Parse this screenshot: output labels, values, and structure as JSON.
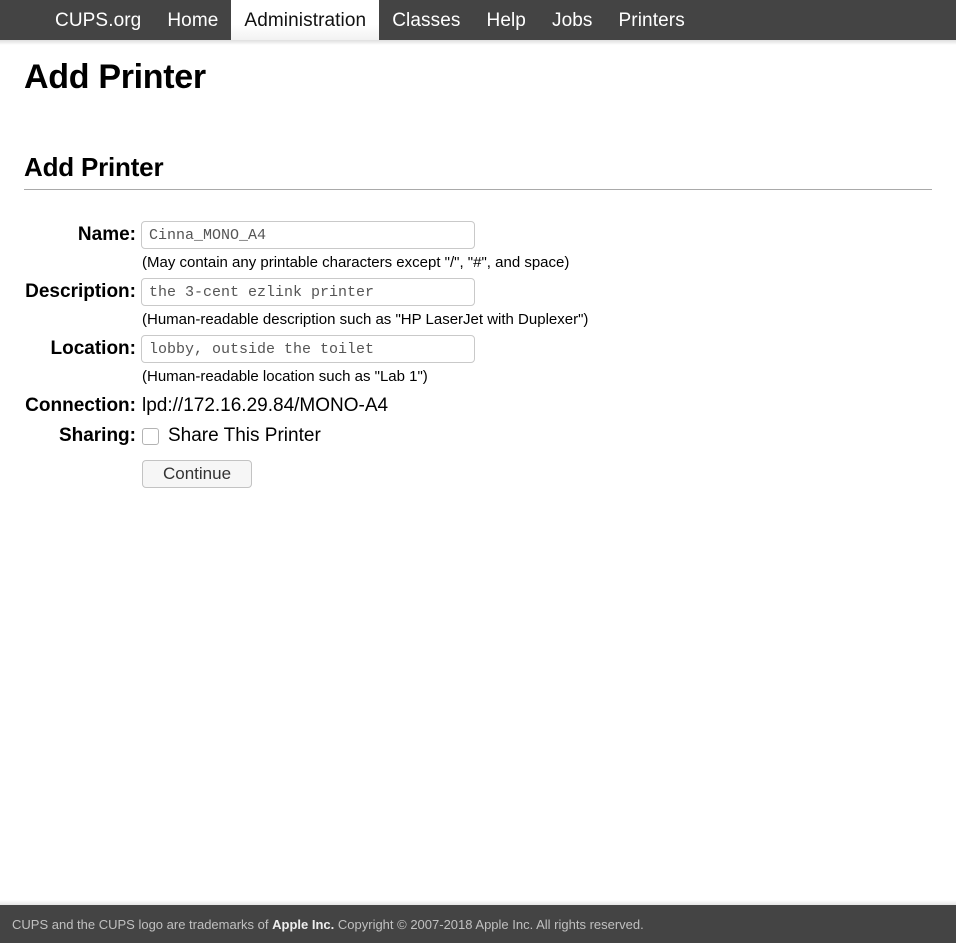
{
  "nav": {
    "items": [
      {
        "label": "CUPS.org",
        "active": false
      },
      {
        "label": "Home",
        "active": false
      },
      {
        "label": "Administration",
        "active": true
      },
      {
        "label": "Classes",
        "active": false
      },
      {
        "label": "Help",
        "active": false
      },
      {
        "label": "Jobs",
        "active": false
      },
      {
        "label": "Printers",
        "active": false
      }
    ]
  },
  "page": {
    "title": "Add Printer",
    "section_title": "Add Printer"
  },
  "form": {
    "name": {
      "label": "Name:",
      "value": "Cinna_MONO_A4",
      "placeholder": "",
      "hint": "(May contain any printable characters except \"/\", \"#\", and space)"
    },
    "description": {
      "label": "Description:",
      "value": "the 3-cent ezlink printer",
      "placeholder": "",
      "hint": "(Human-readable description such as \"HP LaserJet with Duplexer\")"
    },
    "location": {
      "label": "Location:",
      "value": "lobby, outside the toilet",
      "placeholder": "",
      "hint": "(Human-readable location such as \"Lab 1\")"
    },
    "connection": {
      "label": "Connection:",
      "value": "lpd://172.16.29.84/MONO-A4"
    },
    "sharing": {
      "label": "Sharing:",
      "checkbox_label": "Share This Printer",
      "checked": false
    },
    "submit": {
      "label": "Continue"
    }
  },
  "footer": {
    "text_before": "CUPS and the CUPS logo are trademarks of",
    "link": "Apple Inc.",
    "text_after": "Copyright © 2007-2018 Apple Inc. All rights reserved."
  },
  "colors": {
    "nav_bg": "#444444",
    "active_tab_bg": "#ffffff",
    "page_bg": "#ffffff",
    "rule": "#a9a9a9",
    "input_border": "#c9c9c9",
    "footer_bg": "#444444"
  }
}
